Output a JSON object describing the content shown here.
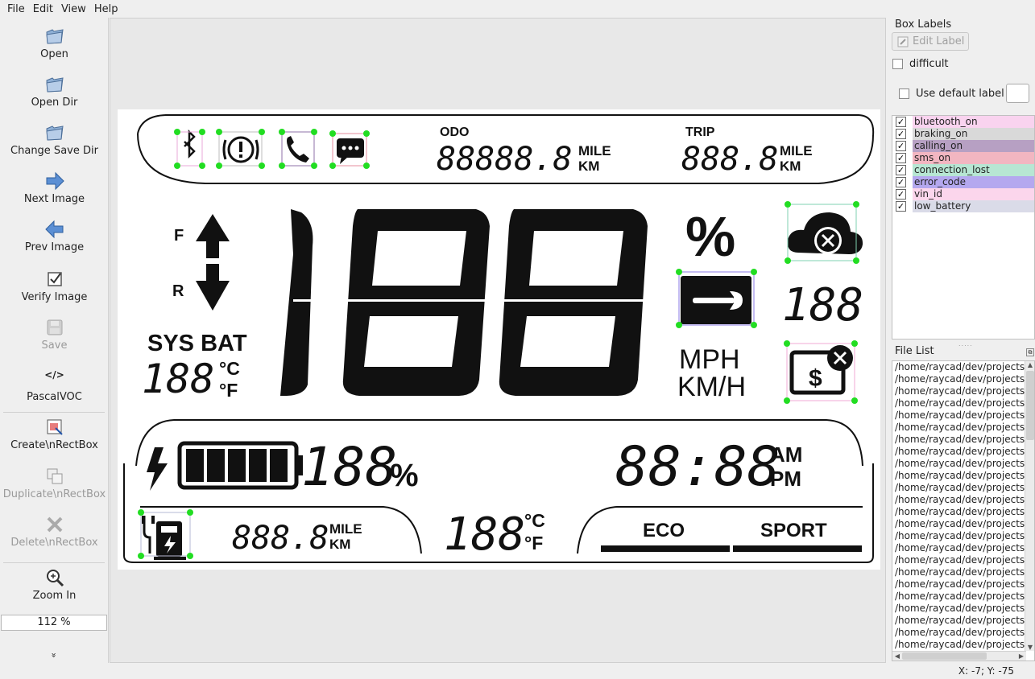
{
  "menu": [
    "File",
    "Edit",
    "View",
    "Help"
  ],
  "toolbar": {
    "open": "Open",
    "open_dir": "Open Dir",
    "change_save_dir": "Change Save Dir",
    "next_image": "Next Image",
    "prev_image": "Prev Image",
    "verify_image": "Verify Image",
    "save": "Save",
    "format_icon": "</>",
    "format": "PascalVOC",
    "create_rect": "Create\\nRectBox",
    "duplicate_rect": "Duplicate\\nRectBox",
    "delete_rect": "Delete\\nRectBox",
    "zoom_in": "Zoom In",
    "zoom_value": "112 %",
    "more": "»"
  },
  "box_labels": {
    "title": "Box Labels",
    "edit_label": "Edit Label",
    "difficult": "difficult",
    "use_default_label": "Use default label",
    "labels": [
      {
        "name": "bluetooth_on",
        "checked": true,
        "color": "#f9d3ef"
      },
      {
        "name": "braking_on",
        "checked": true,
        "color": "#d9d9d9"
      },
      {
        "name": "calling_on",
        "checked": true,
        "color": "#b7a0c3"
      },
      {
        "name": "sms_on",
        "checked": true,
        "color": "#f2b6c1"
      },
      {
        "name": "connection_lost",
        "checked": true,
        "color": "#b7e6d3"
      },
      {
        "name": "error_code",
        "checked": true,
        "color": "#b4a8ef"
      },
      {
        "name": "vin_id",
        "checked": true,
        "color": "#fbd6ec"
      },
      {
        "name": "low_battery",
        "checked": true,
        "color": "#dadbe8"
      }
    ]
  },
  "file_list": {
    "title": "File List",
    "row_text": "/home/raycad/dev/projects",
    "row_count": 24
  },
  "status": {
    "coords": "X: -7; Y: -75"
  },
  "lcd": {
    "odo": "ODO",
    "trip": "TRIP",
    "odo_digits": "88888.8",
    "trip_digits": "888.8",
    "mile": "MILE",
    "km": "KM",
    "f": "F",
    "r": "R",
    "sys_bat": "SYS BAT",
    "temp_digits": "188",
    "deg_c": "°C",
    "deg_f": "°F",
    "percent": "%",
    "code_digits": "188",
    "mph": "MPH",
    "kmh": "KM/H",
    "battery_digits": "188",
    "clock": "88:88",
    "am": "AM",
    "pm": "PM",
    "range_digits": "888.8",
    "temp2_digits": "188",
    "eco": "ECO",
    "sport": "SPORT"
  }
}
